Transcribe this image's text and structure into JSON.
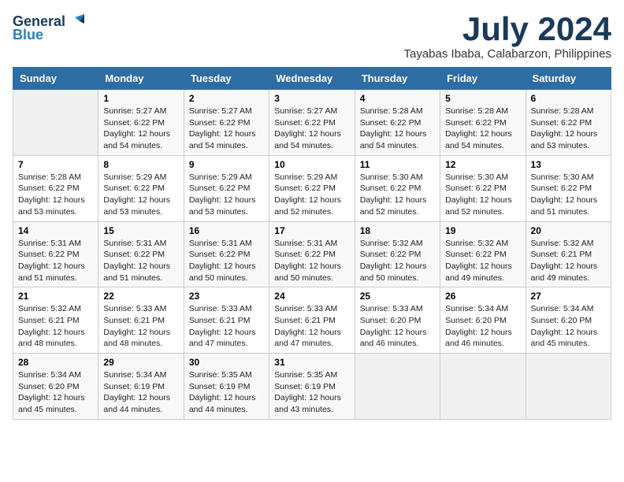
{
  "header": {
    "logo_line1": "General",
    "logo_line2": "Blue",
    "month_year": "July 2024",
    "location": "Tayabas Ibaba, Calabarzon, Philippines"
  },
  "weekdays": [
    "Sunday",
    "Monday",
    "Tuesday",
    "Wednesday",
    "Thursday",
    "Friday",
    "Saturday"
  ],
  "weeks": [
    [
      {
        "day": "",
        "info": ""
      },
      {
        "day": "1",
        "info": "Sunrise: 5:27 AM\nSunset: 6:22 PM\nDaylight: 12 hours\nand 54 minutes."
      },
      {
        "day": "2",
        "info": "Sunrise: 5:27 AM\nSunset: 6:22 PM\nDaylight: 12 hours\nand 54 minutes."
      },
      {
        "day": "3",
        "info": "Sunrise: 5:27 AM\nSunset: 6:22 PM\nDaylight: 12 hours\nand 54 minutes."
      },
      {
        "day": "4",
        "info": "Sunrise: 5:28 AM\nSunset: 6:22 PM\nDaylight: 12 hours\nand 54 minutes."
      },
      {
        "day": "5",
        "info": "Sunrise: 5:28 AM\nSunset: 6:22 PM\nDaylight: 12 hours\nand 54 minutes."
      },
      {
        "day": "6",
        "info": "Sunrise: 5:28 AM\nSunset: 6:22 PM\nDaylight: 12 hours\nand 53 minutes."
      }
    ],
    [
      {
        "day": "7",
        "info": "Sunrise: 5:28 AM\nSunset: 6:22 PM\nDaylight: 12 hours\nand 53 minutes."
      },
      {
        "day": "8",
        "info": "Sunrise: 5:29 AM\nSunset: 6:22 PM\nDaylight: 12 hours\nand 53 minutes."
      },
      {
        "day": "9",
        "info": "Sunrise: 5:29 AM\nSunset: 6:22 PM\nDaylight: 12 hours\nand 53 minutes."
      },
      {
        "day": "10",
        "info": "Sunrise: 5:29 AM\nSunset: 6:22 PM\nDaylight: 12 hours\nand 52 minutes."
      },
      {
        "day": "11",
        "info": "Sunrise: 5:30 AM\nSunset: 6:22 PM\nDaylight: 12 hours\nand 52 minutes."
      },
      {
        "day": "12",
        "info": "Sunrise: 5:30 AM\nSunset: 6:22 PM\nDaylight: 12 hours\nand 52 minutes."
      },
      {
        "day": "13",
        "info": "Sunrise: 5:30 AM\nSunset: 6:22 PM\nDaylight: 12 hours\nand 51 minutes."
      }
    ],
    [
      {
        "day": "14",
        "info": "Sunrise: 5:31 AM\nSunset: 6:22 PM\nDaylight: 12 hours\nand 51 minutes."
      },
      {
        "day": "15",
        "info": "Sunrise: 5:31 AM\nSunset: 6:22 PM\nDaylight: 12 hours\nand 51 minutes."
      },
      {
        "day": "16",
        "info": "Sunrise: 5:31 AM\nSunset: 6:22 PM\nDaylight: 12 hours\nand 50 minutes."
      },
      {
        "day": "17",
        "info": "Sunrise: 5:31 AM\nSunset: 6:22 PM\nDaylight: 12 hours\nand 50 minutes."
      },
      {
        "day": "18",
        "info": "Sunrise: 5:32 AM\nSunset: 6:22 PM\nDaylight: 12 hours\nand 50 minutes."
      },
      {
        "day": "19",
        "info": "Sunrise: 5:32 AM\nSunset: 6:22 PM\nDaylight: 12 hours\nand 49 minutes."
      },
      {
        "day": "20",
        "info": "Sunrise: 5:32 AM\nSunset: 6:21 PM\nDaylight: 12 hours\nand 49 minutes."
      }
    ],
    [
      {
        "day": "21",
        "info": "Sunrise: 5:32 AM\nSunset: 6:21 PM\nDaylight: 12 hours\nand 48 minutes."
      },
      {
        "day": "22",
        "info": "Sunrise: 5:33 AM\nSunset: 6:21 PM\nDaylight: 12 hours\nand 48 minutes."
      },
      {
        "day": "23",
        "info": "Sunrise: 5:33 AM\nSunset: 6:21 PM\nDaylight: 12 hours\nand 47 minutes."
      },
      {
        "day": "24",
        "info": "Sunrise: 5:33 AM\nSunset: 6:21 PM\nDaylight: 12 hours\nand 47 minutes."
      },
      {
        "day": "25",
        "info": "Sunrise: 5:33 AM\nSunset: 6:20 PM\nDaylight: 12 hours\nand 46 minutes."
      },
      {
        "day": "26",
        "info": "Sunrise: 5:34 AM\nSunset: 6:20 PM\nDaylight: 12 hours\nand 46 minutes."
      },
      {
        "day": "27",
        "info": "Sunrise: 5:34 AM\nSunset: 6:20 PM\nDaylight: 12 hours\nand 45 minutes."
      }
    ],
    [
      {
        "day": "28",
        "info": "Sunrise: 5:34 AM\nSunset: 6:20 PM\nDaylight: 12 hours\nand 45 minutes."
      },
      {
        "day": "29",
        "info": "Sunrise: 5:34 AM\nSunset: 6:19 PM\nDaylight: 12 hours\nand 44 minutes."
      },
      {
        "day": "30",
        "info": "Sunrise: 5:35 AM\nSunset: 6:19 PM\nDaylight: 12 hours\nand 44 minutes."
      },
      {
        "day": "31",
        "info": "Sunrise: 5:35 AM\nSunset: 6:19 PM\nDaylight: 12 hours\nand 43 minutes."
      },
      {
        "day": "",
        "info": ""
      },
      {
        "day": "",
        "info": ""
      },
      {
        "day": "",
        "info": ""
      }
    ]
  ]
}
